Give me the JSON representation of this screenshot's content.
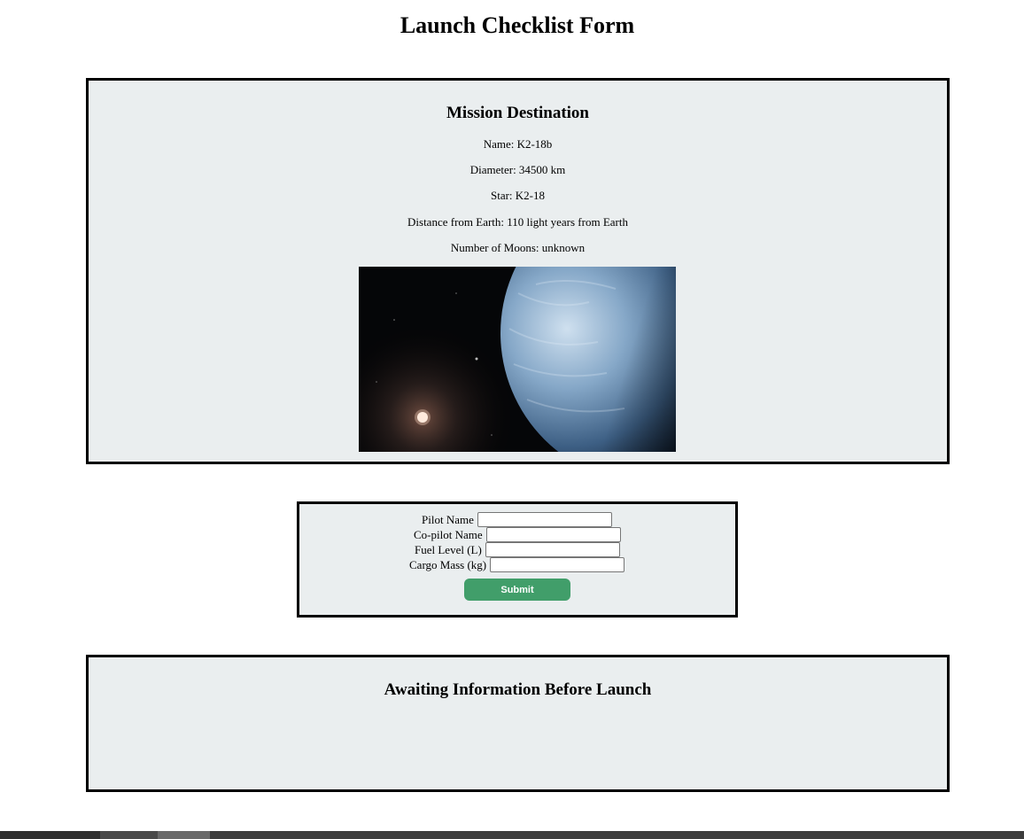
{
  "page": {
    "title": "Launch Checklist Form"
  },
  "mission": {
    "heading": "Mission Destination",
    "name": "Name: K2-18b",
    "diameter": "Diameter: 34500 km",
    "star": "Star: K2-18",
    "distance": "Distance from Earth: 110 light years from Earth",
    "moons": "Number of Moons: unknown"
  },
  "form": {
    "pilot_label": "Pilot Name",
    "pilot_value": "",
    "copilot_label": "Co-pilot Name",
    "copilot_value": "",
    "fuel_label": "Fuel Level (L)",
    "fuel_value": "",
    "cargo_label": "Cargo Mass (kg)",
    "cargo_value": "",
    "submit_label": "Submit"
  },
  "status": {
    "heading": "Awaiting Information Before Launch"
  },
  "colors": {
    "panel_background": "#eaeeef",
    "submit_button": "#419e6a"
  }
}
